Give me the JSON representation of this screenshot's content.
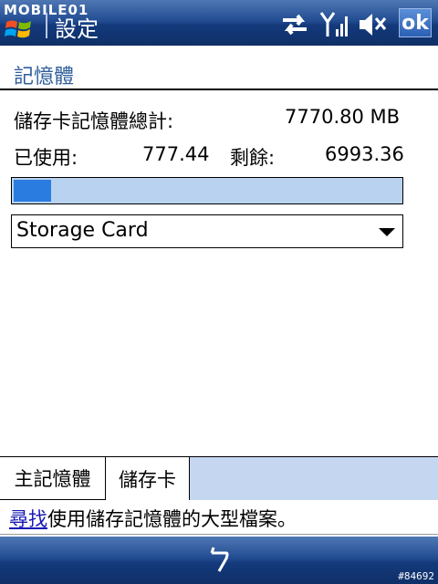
{
  "titlebar": {
    "brand": "MOBILE01",
    "title": "設定",
    "ok_label": "ok"
  },
  "icons": {
    "start": "windows-flag-icon",
    "connectivity": "sync-arrows-icon",
    "signal": "signal-strength-icon",
    "volume": "speaker-muted-icon",
    "keyboard": "input-method-icon"
  },
  "section": {
    "title": "記憶體"
  },
  "memory": {
    "total_label": "儲存卡記憶體總計:",
    "total_value": "7770.80 MB",
    "used_label": "已使用:",
    "used_value": "777.44",
    "free_label": "剩餘:",
    "free_value": "6993.36",
    "usage_percent": 10
  },
  "selector": {
    "value": "Storage Card"
  },
  "tabs": [
    {
      "label": "主記憶體",
      "active": false
    },
    {
      "label": "儲存卡",
      "active": true
    }
  ],
  "footer": {
    "link": "尋找",
    "text": "使用儲存記憶體的大型檔案。"
  },
  "watermark": "#84692",
  "colors": {
    "bar_dark": "#143a7c",
    "accent": "#2b7ce0",
    "track": "#b9d2ef",
    "section_title": "#2f5f9b"
  }
}
